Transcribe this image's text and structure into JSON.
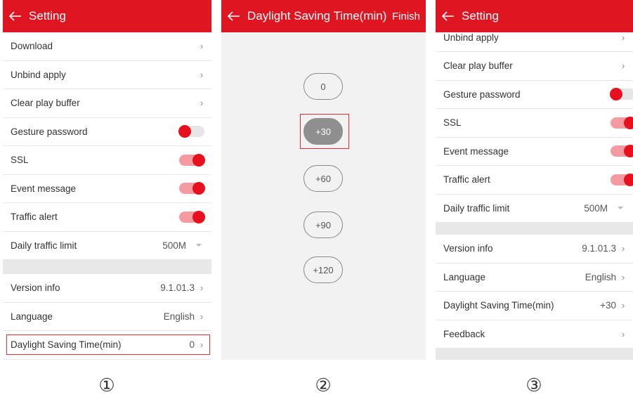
{
  "panel1": {
    "title": "Setting",
    "rows": {
      "download": "Download",
      "unbind": "Unbind apply",
      "clear": "Clear play buffer",
      "gesture": "Gesture password",
      "ssl": "SSL",
      "event": "Event message",
      "traffic": "Traffic alert",
      "daily": "Daily traffic limit",
      "daily_value": "500M",
      "version": "Version info",
      "version_value": "9.1.01.3",
      "language": "Language",
      "language_value": "English",
      "dst": "Daylight Saving Time(min)",
      "dst_value": "0"
    },
    "toggles": {
      "gesture": "off",
      "ssl": "on",
      "event": "on",
      "traffic": "on"
    }
  },
  "panel2": {
    "title": "Daylight Saving Time(min)",
    "finish": "Finish",
    "options": [
      "0",
      "+30",
      "+60",
      "+90",
      "+120"
    ],
    "selected": "+30"
  },
  "panel3": {
    "title": "Setting",
    "rows": {
      "unbind": "Unbind apply",
      "clear": "Clear play buffer",
      "gesture": "Gesture password",
      "ssl": "SSL",
      "event": "Event message",
      "traffic": "Traffic alert",
      "daily": "Daily traffic limit",
      "daily_value": "500M",
      "version": "Version info",
      "version_value": "9.1.01.3",
      "language": "Language",
      "language_value": "English",
      "dst": "Daylight Saving Time(min)",
      "dst_value": "+30",
      "feedback": "Feedback"
    },
    "toggles": {
      "gesture": "off",
      "ssl": "on",
      "event": "on",
      "traffic": "on"
    }
  },
  "step_labels": [
    "①",
    "②",
    "③"
  ],
  "icons": {
    "back": "back-arrow-icon",
    "chevron": "chevron-right-icon",
    "caret": "caret-down-icon"
  },
  "colors": {
    "header": "#e01522",
    "toggle_knob": "#e8101c",
    "toggle_track_on": "#f69aa1",
    "highlight": "#e42d37"
  }
}
